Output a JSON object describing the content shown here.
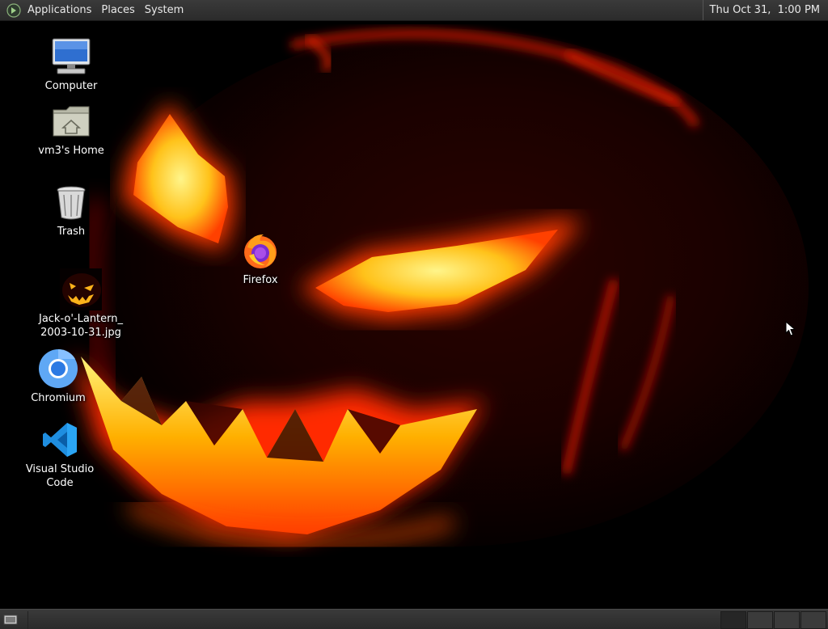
{
  "top_panel": {
    "menus": [
      "Applications",
      "Places",
      "System"
    ],
    "clock": "Thu Oct 31,  1:00 PM"
  },
  "desktop": {
    "icons": [
      {
        "label": "Computer",
        "icon": "computer-icon"
      },
      {
        "label": "vm3's Home",
        "icon": "home-folder-icon"
      },
      {
        "label": "Trash",
        "icon": "trash-icon"
      },
      {
        "label": "Firefox",
        "icon": "firefox-icon"
      },
      {
        "label": "Jack-o'-Lantern_\n2003-10-31.jpg",
        "icon": "image-file-icon"
      },
      {
        "label": "Chromium",
        "icon": "chromium-icon"
      },
      {
        "label": "Visual Studio Code",
        "icon": "vscode-icon"
      }
    ]
  },
  "bottom_panel": {
    "workspaces": 4,
    "active_workspace": 1
  }
}
